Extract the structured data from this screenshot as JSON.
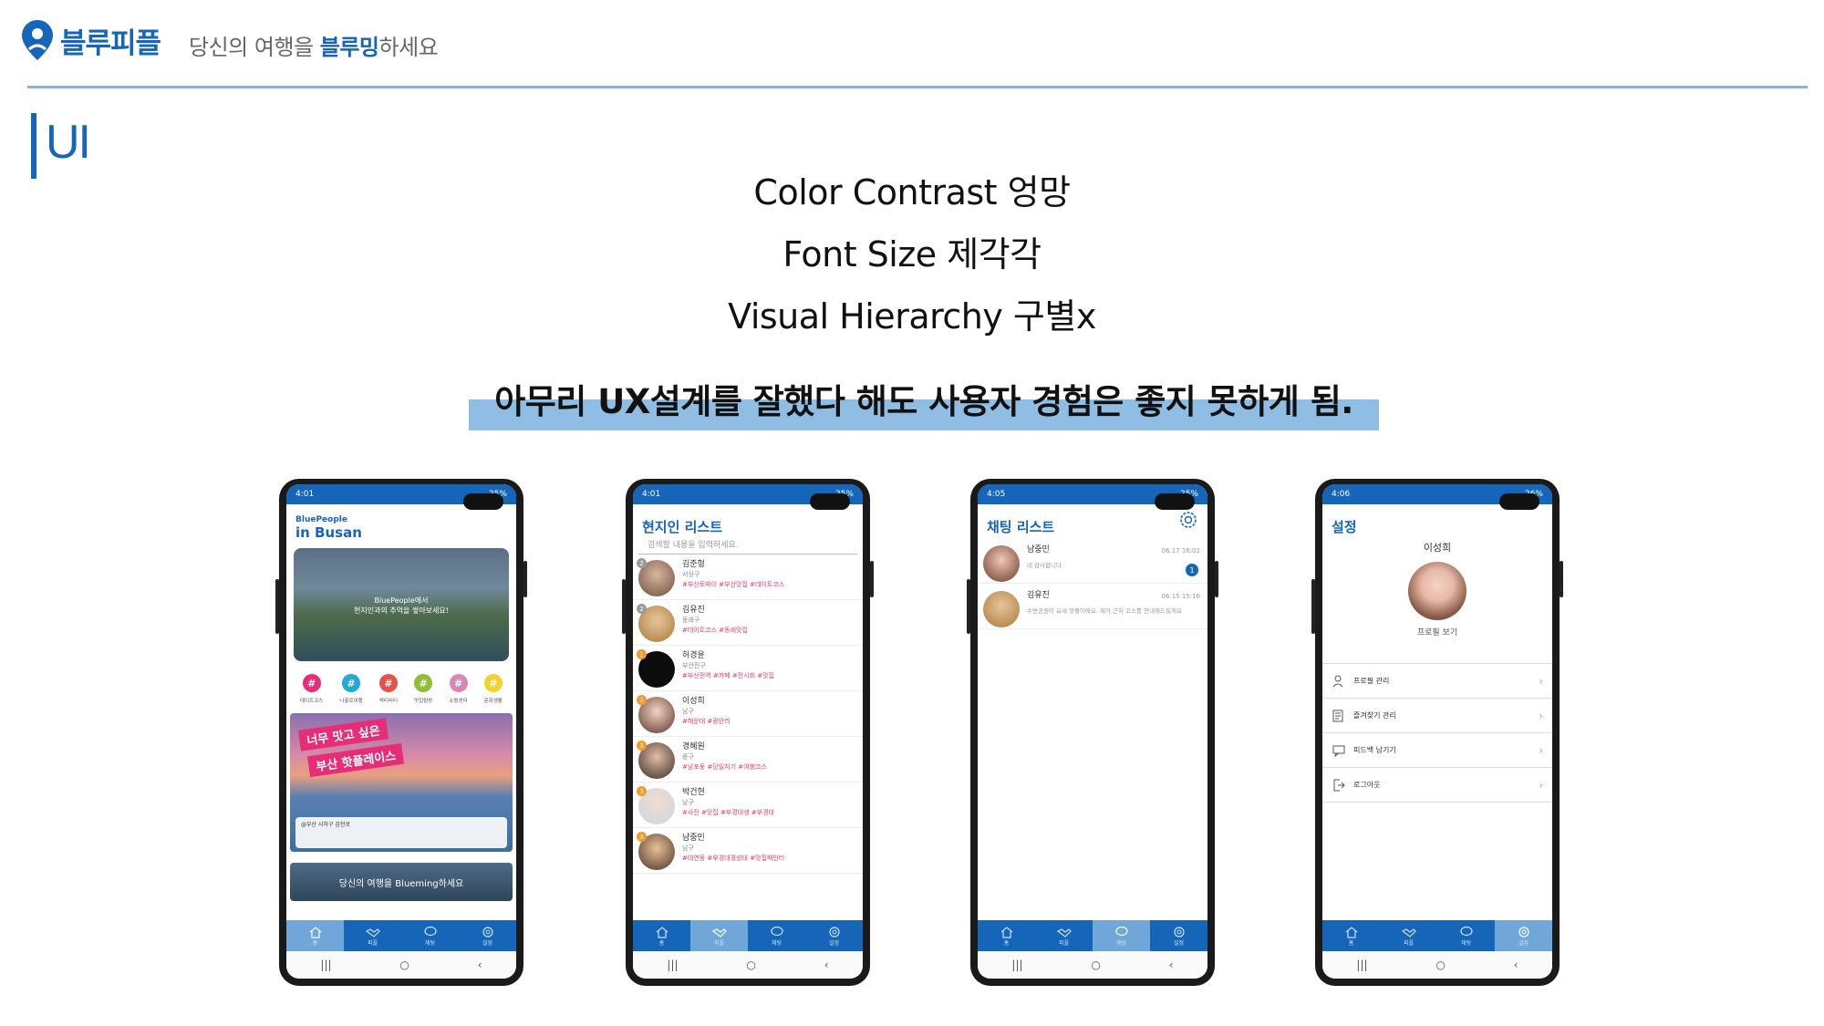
{
  "header": {
    "logo_text": "블루피플",
    "tagline_pre": "당신의 여행을 ",
    "tagline_hl": "블루밍",
    "tagline_post": "하세요"
  },
  "section": {
    "title": "UI"
  },
  "headlines": [
    "Color Contrast 엉망",
    "Font Size 제각각",
    "Visual Hierarchy 구별x"
  ],
  "emphasis": "아무리 UX설계를 잘했다 해도 사용자 경험은 좋지 못하게 됨.",
  "colors": {
    "brand": "#1565b8",
    "highlight": "#8fbde3",
    "tag": "#e83a6a"
  },
  "phones": {
    "home": {
      "status_time": "4:01",
      "status_right": "25%",
      "brand": "BluePeople",
      "city": "in Busan",
      "hero_text_1": "BluePeople에서",
      "hero_text_2": "현지인과의 추억을 쌓아보세요!",
      "categories": [
        {
          "icon": "#",
          "label": "데이트코스",
          "color": "#e82d78"
        },
        {
          "icon": "#",
          "label": "나홀로여행",
          "color": "#23a9d6"
        },
        {
          "icon": "#",
          "label": "액티비티",
          "color": "#e8504a"
        },
        {
          "icon": "#",
          "label": "맛집탐방",
          "color": "#8fbf3a"
        },
        {
          "icon": "#",
          "label": "쇼핑센터",
          "color": "#d986b6"
        },
        {
          "icon": "#",
          "label": "문화생활",
          "color": "#f2d22e"
        }
      ],
      "banner_tag1": "너무 맛고 싶은",
      "banner_tag2": "부산 핫플레이스",
      "banner_note": "@부산 사하구 감천로",
      "strip_text": "당신의 여행을 Blueming하세요",
      "tabs": [
        "홈",
        "피플",
        "채팅",
        "설정"
      ]
    },
    "people": {
      "status_time": "4:01",
      "status_right": "25%",
      "title": "현지인 리스트",
      "search_placeholder": "검색할 내용을 입력하세요.",
      "items": [
        {
          "rank": "2",
          "name": "김준형",
          "area": "서상구",
          "tags": "#부산토박이 #부산맛집 #데이트코스"
        },
        {
          "rank": "2",
          "name": "김유진",
          "area": "동래구",
          "tags": "#데이트코스 #동래맛집"
        },
        {
          "rank": "1",
          "name": "허경윤",
          "area": "부산진구",
          "tags": "#부산전역 #카페 #전시회 #맛집"
        },
        {
          "rank": "3",
          "name": "이성희",
          "area": "남구",
          "tags": "#해운대 #광안리"
        },
        {
          "rank": "3",
          "name": "경혜원",
          "area": "중구",
          "tags": "#남포동 #당일치기 #여행코스"
        },
        {
          "rank": "3",
          "name": "박건현",
          "area": "남구",
          "tags": "#사진 #맛집 #부경대생 #부경대"
        },
        {
          "rank": "3",
          "name": "남중민",
          "area": "남구",
          "tags": "#대연동 #부경대경성대 #맛집페인터"
        }
      ],
      "tabs": [
        "홈",
        "피플",
        "채팅",
        "설정"
      ]
    },
    "chat": {
      "status_time": "4:05",
      "status_right": "25%",
      "title": "채팅 리스트",
      "items": [
        {
          "name": "남중민",
          "message": "네 감사합니다.",
          "time": "06.17 16:02",
          "badge": "1"
        },
        {
          "name": "김유진",
          "message": "수변공원이 요새 핫플이에요. 제가 근처 코스를 안내해드릴게요",
          "time": "06.15 15:16",
          "badge": ""
        }
      ],
      "tabs": [
        "홈",
        "피플",
        "채팅",
        "설정"
      ]
    },
    "settings": {
      "status_time": "4:06",
      "status_right": "26%",
      "title": "설정",
      "profile_name": "이성희",
      "profile_link": "프로필 보기",
      "items": [
        "프로필 관리",
        "즐겨찾기 관리",
        "피드백 남기기",
        "로그아웃"
      ],
      "tabs": [
        "홈",
        "피플",
        "채팅",
        "설정"
      ]
    }
  }
}
